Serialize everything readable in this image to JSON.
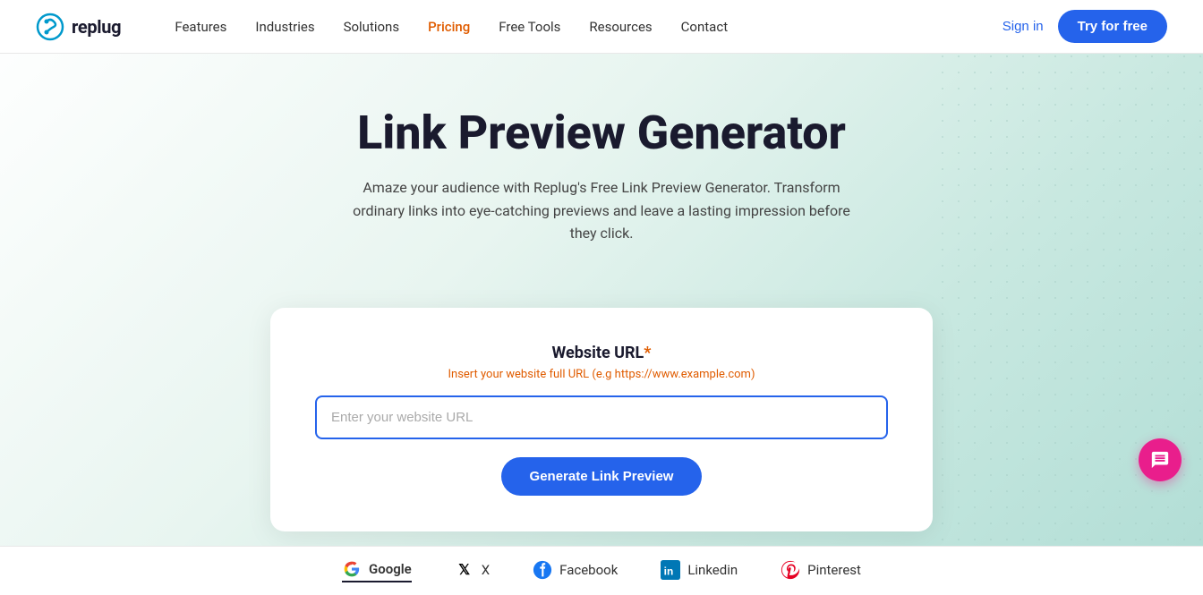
{
  "brand": {
    "name": "replug",
    "logo_alt": "Replug logo"
  },
  "nav": {
    "links": [
      {
        "label": "Features",
        "active": false
      },
      {
        "label": "Industries",
        "active": false
      },
      {
        "label": "Solutions",
        "active": false
      },
      {
        "label": "Pricing",
        "active": true
      },
      {
        "label": "Free Tools",
        "active": false
      },
      {
        "label": "Resources",
        "active": false
      },
      {
        "label": "Contact",
        "active": false
      }
    ],
    "sign_in_label": "Sign in",
    "try_free_label": "Try for free"
  },
  "hero": {
    "title": "Link Preview Generator",
    "subtitle": "Amaze your audience with Replug's Free Link Preview Generator. Transform ordinary links into eye-catching previews and leave a lasting impression before they click."
  },
  "form": {
    "label": "Website URL",
    "required_marker": "*",
    "hint": "Insert your website full URL (e.g https://www.example.com)",
    "input_placeholder": "Enter your website URL",
    "button_label": "Generate Link Preview"
  },
  "tabs": [
    {
      "label": "Google",
      "icon": "G",
      "active": true
    },
    {
      "label": "X",
      "icon": "𝕏",
      "active": false
    },
    {
      "label": "Facebook",
      "icon": "f",
      "active": false
    },
    {
      "label": "Linkedin",
      "icon": "in",
      "active": false
    },
    {
      "label": "Pinterest",
      "icon": "P",
      "active": false
    }
  ],
  "chat": {
    "label": "Chat support"
  }
}
